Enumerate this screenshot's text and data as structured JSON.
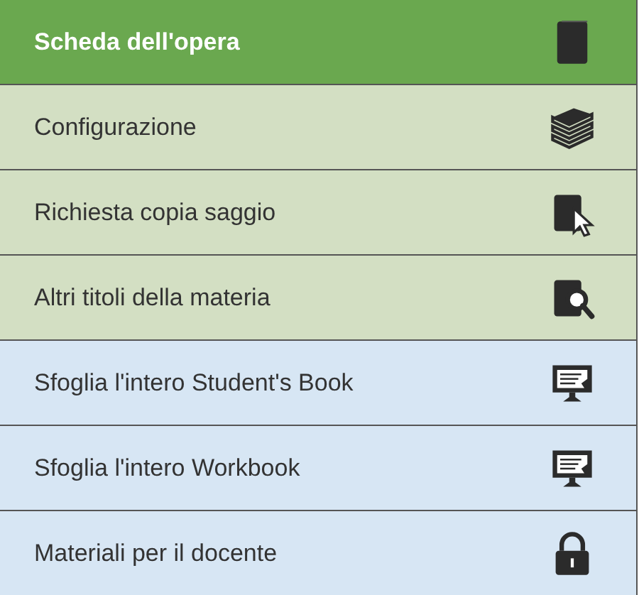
{
  "menu": [
    {
      "label": "Scheda dell'opera",
      "selected": true,
      "color": "#6aa84f",
      "kind": "book"
    },
    {
      "label": "Configurazione",
      "selected": false,
      "color": "#d3dfc3",
      "kind": "books"
    },
    {
      "label": "Richiesta copia saggio",
      "selected": false,
      "color": "#d3dfc3",
      "kind": "pointer"
    },
    {
      "label": "Altri titoli della materia",
      "selected": false,
      "color": "#d3dfc3",
      "kind": "search"
    },
    {
      "label": "Sfoglia l'intero Student's Book",
      "selected": false,
      "color": "#d7e6f4",
      "kind": "monitor"
    },
    {
      "label": "Sfoglia l'intero Workbook",
      "selected": false,
      "color": "#d7e6f4",
      "kind": "monitor"
    },
    {
      "label": "Materiali per il docente",
      "selected": false,
      "color": "#d7e6f4",
      "kind": "lock"
    }
  ]
}
